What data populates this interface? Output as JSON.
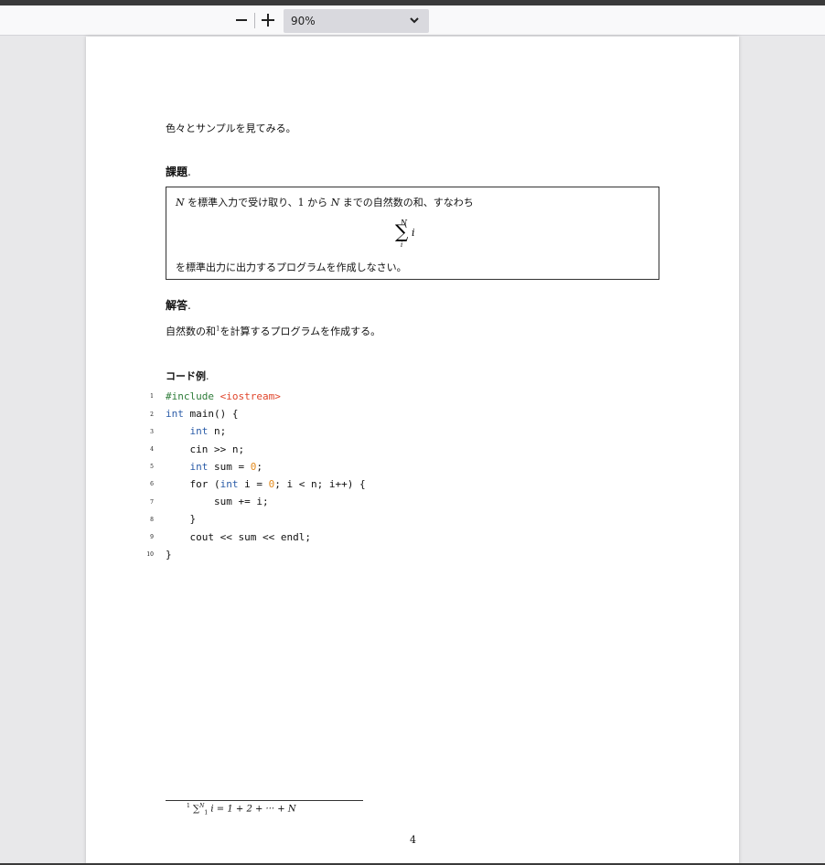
{
  "toolbar": {
    "zoom_out_icon": "minus-icon",
    "zoom_in_icon": "plus-icon",
    "zoom_value": "90%",
    "dropdown_icon": "chevron-down-icon"
  },
  "document": {
    "intro": "色々とサンプルを見てみる。",
    "task_heading": "課題",
    "task_heading_dot": ".",
    "task_line1_a": "を標準入力で受け取り、1 から ",
    "task_line1_b": " までの自然数の和、すなわち",
    "task_var_N": "N",
    "sum_upper": "N",
    "sum_sigma": "∑",
    "sum_lower": "i",
    "sum_term": "i",
    "task_line2": "を標準出力に出力するプログラムを作成しなさい。",
    "answer_heading": "解答",
    "answer_heading_dot": ".",
    "answer_text_a": "自然数の和",
    "answer_footnote_mark": "1",
    "answer_text_b": "を計算するプログラムを作成する。",
    "code_heading": "コード例",
    "code_heading_dot": ".",
    "code_lines": [
      {
        "n": "1"
      },
      {
        "n": "2"
      },
      {
        "n": "3"
      },
      {
        "n": "4"
      },
      {
        "n": "5"
      },
      {
        "n": "6"
      },
      {
        "n": "7"
      },
      {
        "n": "8"
      },
      {
        "n": "9"
      },
      {
        "n": "10"
      }
    ],
    "code_tokens": {
      "include": "#include",
      "header": "<iostream>",
      "int": "int",
      "main": " main() {",
      "n_decl": " n;",
      "cin": "cin >> n;",
      "sum_decl_a": " sum = ",
      "zero": "0",
      "semi": ";",
      "for_a": "for (",
      "for_b": " i = ",
      "for_c": "; i < n; i++) {",
      "sum_add": "sum += i;",
      "close_inner": "}",
      "cout": "cout << sum << endl;",
      "close_outer": "}"
    },
    "footnote_mark": "1",
    "footnote_sigma": "∑",
    "footnote_upper": "N",
    "footnote_lower": "1",
    "footnote_rest": " i = 1 + 2 + ··· + N",
    "page_number": "4"
  }
}
